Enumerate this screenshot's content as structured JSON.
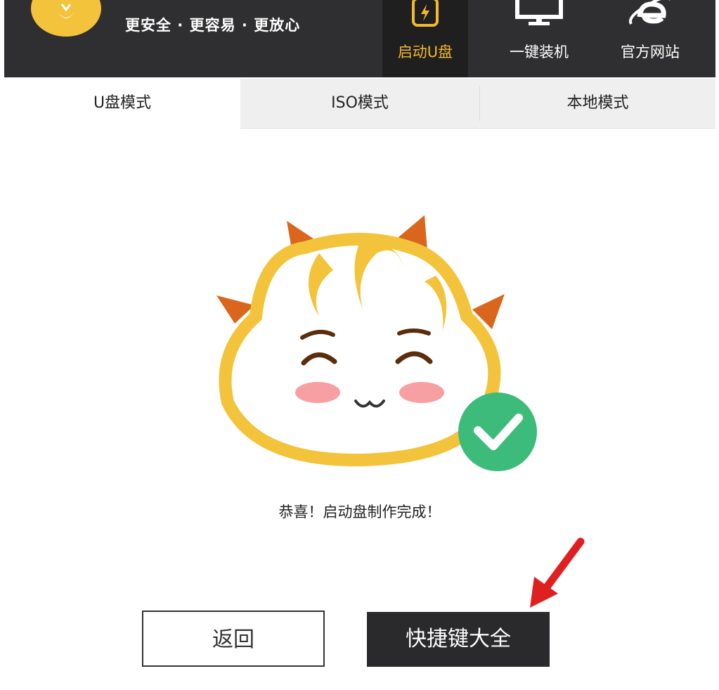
{
  "header": {
    "slogan": "更安全 · 更容易 · 更放心",
    "nav": [
      {
        "label": "启动U盘",
        "icon": "usb-flash-icon",
        "active": true
      },
      {
        "label": "一键装机",
        "icon": "monitor-icon",
        "active": false
      },
      {
        "label": "官方网站",
        "icon": "ie-browser-icon",
        "active": false
      }
    ]
  },
  "tabs": [
    {
      "label": "U盘模式",
      "active": true
    },
    {
      "label": "ISO模式",
      "active": false
    },
    {
      "label": "本地模式",
      "active": false
    }
  ],
  "main": {
    "message": "恭喜！启动盘制作完成！",
    "mascot_icon": "smiling-mascot-icon",
    "success_icon": "checkmark-icon"
  },
  "buttons": {
    "back": "返回",
    "shortcuts": "快捷键大全"
  },
  "colors": {
    "header_bg": "#2f2f31",
    "accent_yellow": "#f3b82d",
    "success_green": "#3dbb7b",
    "arrow_red": "#e02020"
  }
}
